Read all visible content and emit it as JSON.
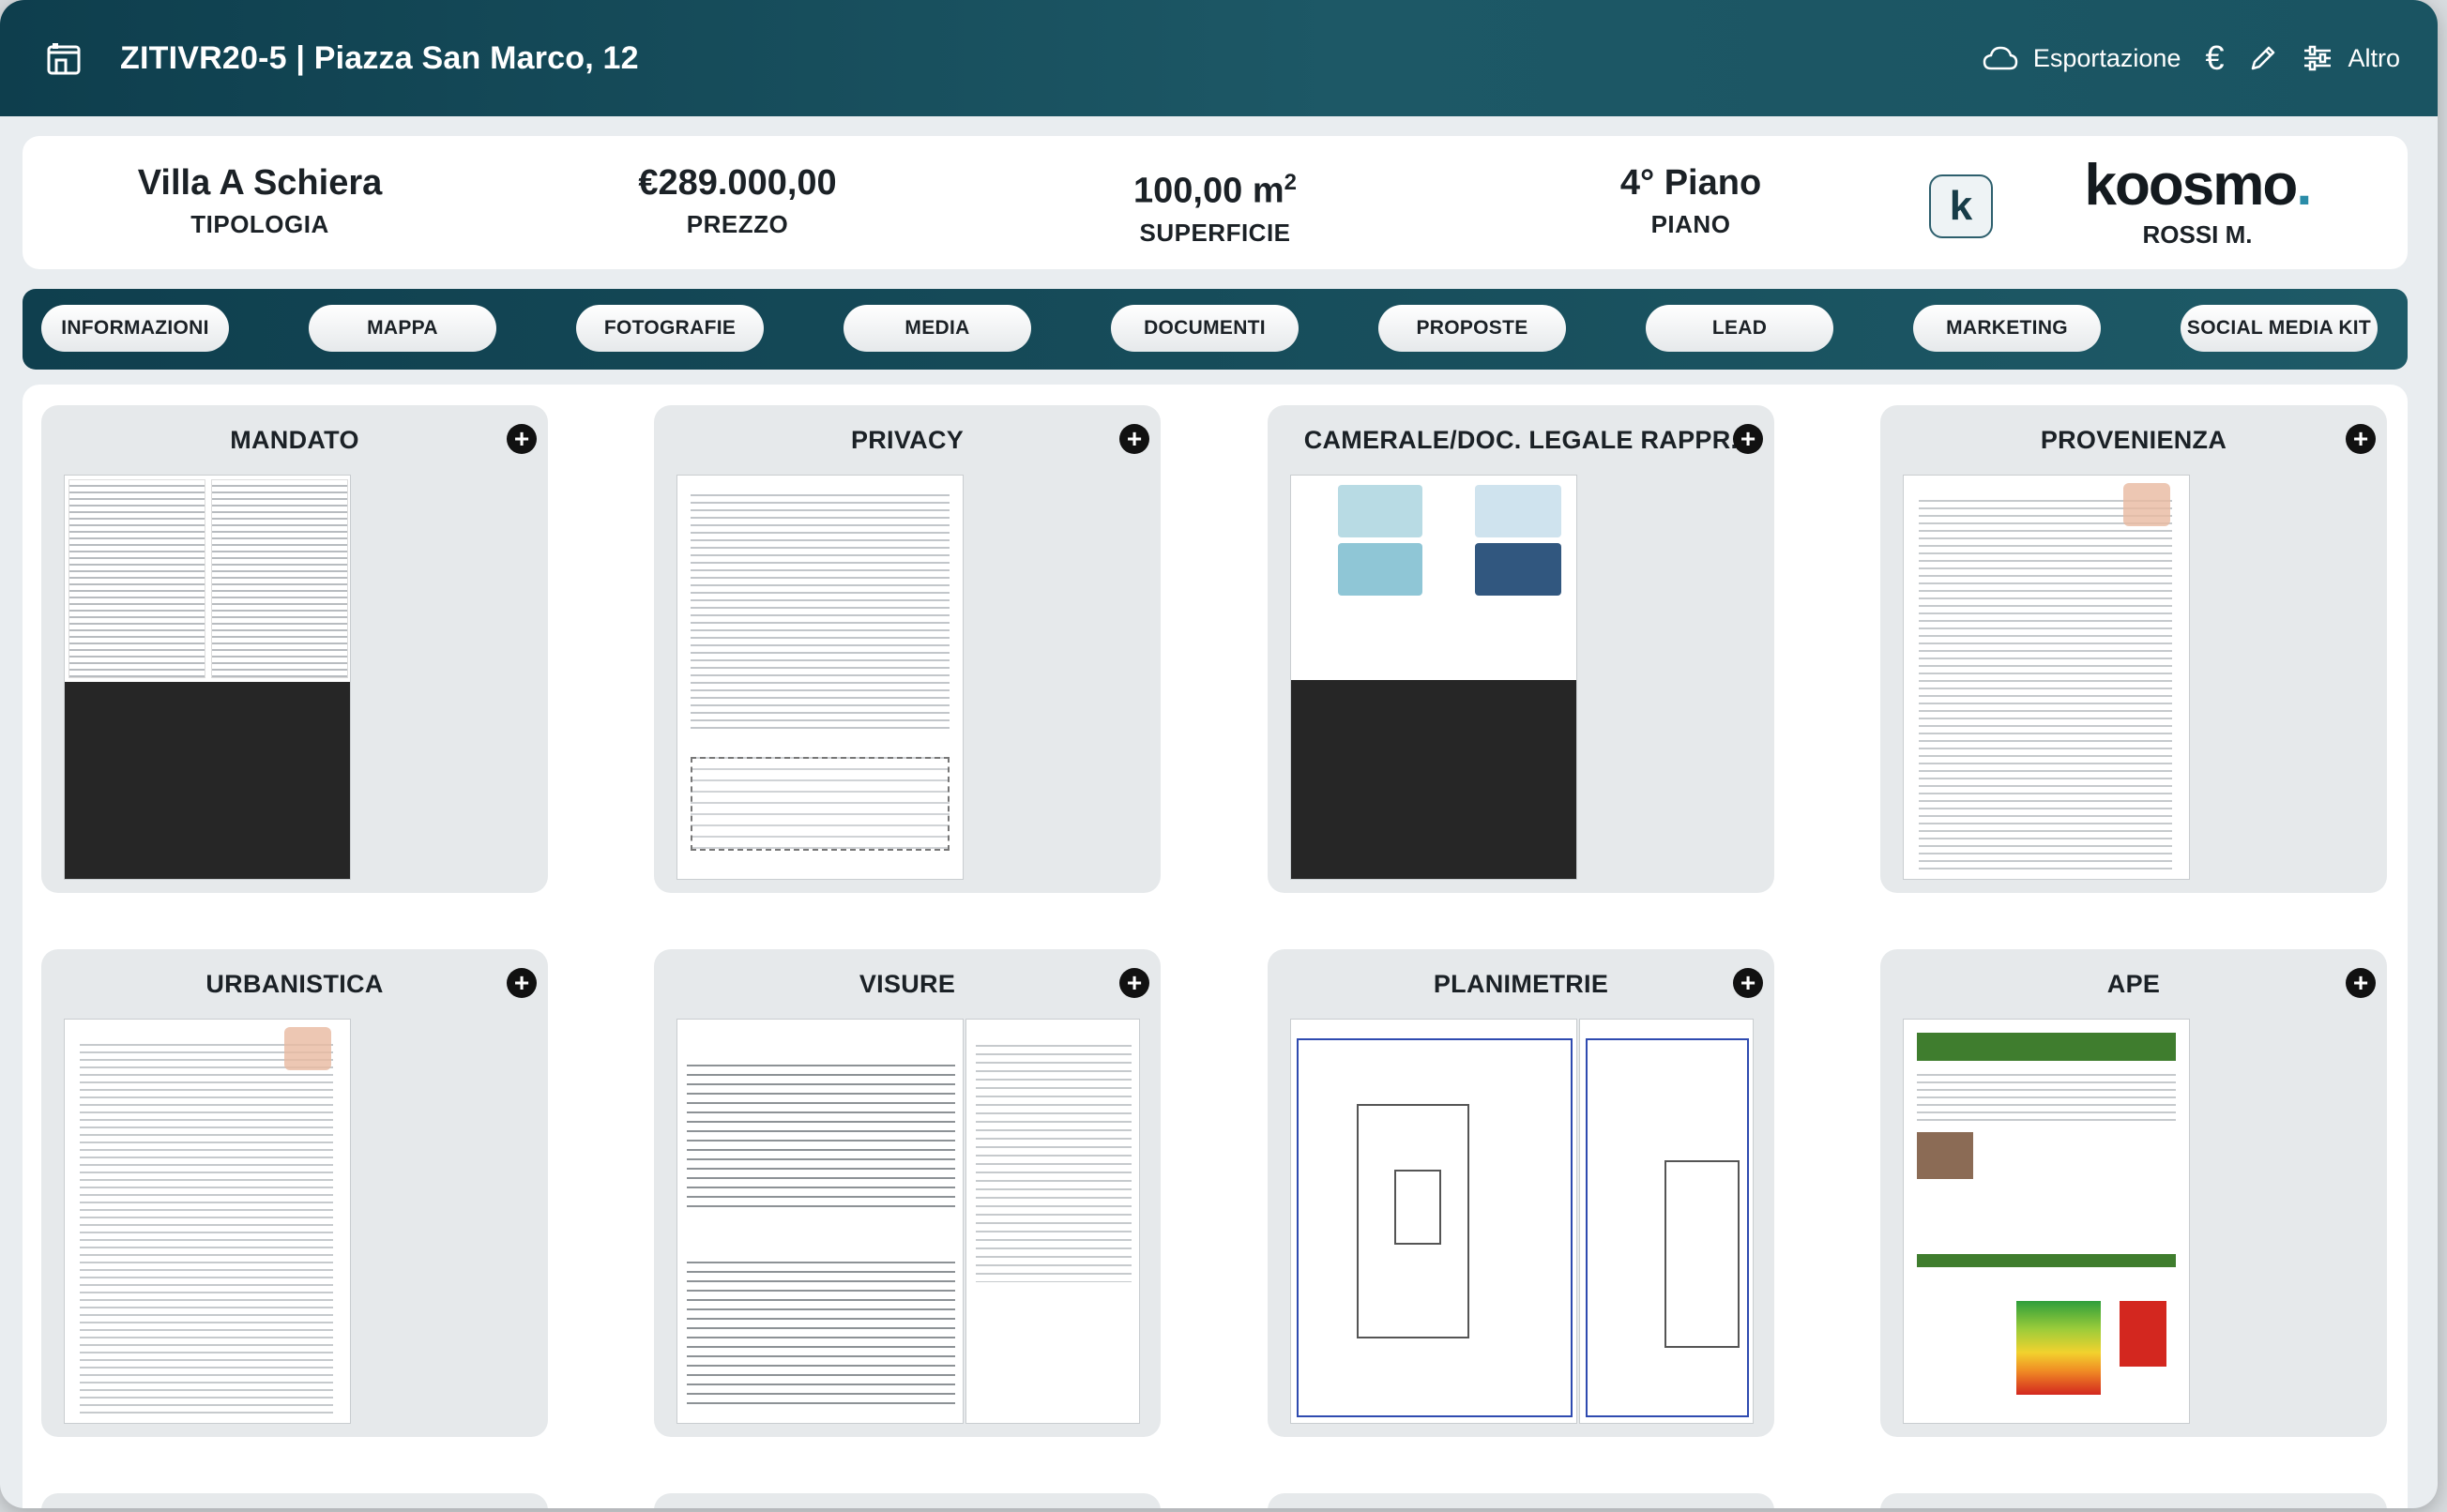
{
  "header": {
    "title": "ZITIVR20-5 | Piazza San Marco, 12",
    "actions": {
      "export_label": "Esportazione",
      "currency_icon": "€",
      "more_label": "Altro"
    }
  },
  "summary": {
    "tipologia_value": "Villa A Schiera",
    "tipologia_label": "TIPOLOGIA",
    "prezzo_value": "€289.000,00",
    "prezzo_label": "PREZZO",
    "superficie_value": "100,00 m",
    "superficie_unit_sup": "2",
    "superficie_label": "SUPERFICIE",
    "piano_value": "4° Piano",
    "piano_label": "PIANO",
    "badge_letter": "k",
    "brand_logo": "koosmo",
    "brand_dot": ".",
    "agent": "ROSSI M."
  },
  "tabs": [
    {
      "label": "INFORMAZIONI"
    },
    {
      "label": "MAPPA"
    },
    {
      "label": "FOTOGRAFIE"
    },
    {
      "label": "MEDIA"
    },
    {
      "label": "DOCUMENTI"
    },
    {
      "label": "PROPOSTE"
    },
    {
      "label": "LEAD"
    },
    {
      "label": "MARKETING"
    },
    {
      "label": "SOCIAL MEDIA KIT"
    }
  ],
  "documents": [
    {
      "title": "MANDATO"
    },
    {
      "title": "PRIVACY"
    },
    {
      "title": "CAMERALE/DOC. LEGALE RAPPR."
    },
    {
      "title": "PROVENIENZA"
    },
    {
      "title": "URBANISTICA"
    },
    {
      "title": "VISURE"
    },
    {
      "title": "PLANIMETRIE"
    },
    {
      "title": "APE"
    }
  ],
  "add_symbol": "+",
  "colors": {
    "header_gradient_start": "#0e3e4d",
    "header_gradient_end": "#1d5866",
    "brand_accent": "#2a8ca8",
    "card_bg": "#e6e9eb"
  }
}
